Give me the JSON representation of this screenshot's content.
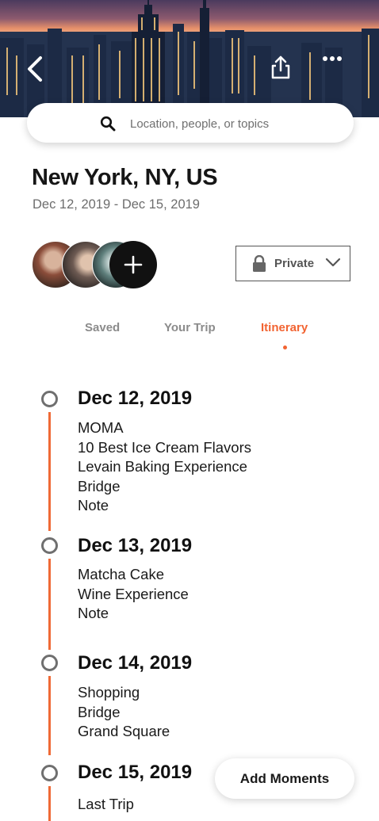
{
  "search": {
    "placeholder": "Location, people, or topics"
  },
  "trip": {
    "title": "New York, NY, US",
    "dates": "Dec 12, 2019 - Dec 15, 2019"
  },
  "privacy": {
    "label": "Private"
  },
  "tabs": [
    {
      "label": "Saved",
      "active": false
    },
    {
      "label": "Your Trip",
      "active": false
    },
    {
      "label": "Itinerary",
      "active": true
    }
  ],
  "colors": {
    "accent": "#f26432",
    "node": "#6f6f6f"
  },
  "itinerary": [
    {
      "date": "Dec 12, 2019",
      "items": [
        "MOMA",
        "10 Best Ice Cream Flavors",
        "Levain Baking Experience",
        "Bridge",
        "Note"
      ]
    },
    {
      "date": "Dec 13, 2019",
      "items": [
        "Matcha Cake",
        "Wine Experience",
        "Note"
      ]
    },
    {
      "date": "Dec 14, 2019",
      "items": [
        "Shopping",
        "Bridge",
        "Grand Square"
      ]
    },
    {
      "date": "Dec 15, 2019",
      "items": [
        "Last Trip"
      ]
    }
  ],
  "add_moments_label": "Add Moments"
}
